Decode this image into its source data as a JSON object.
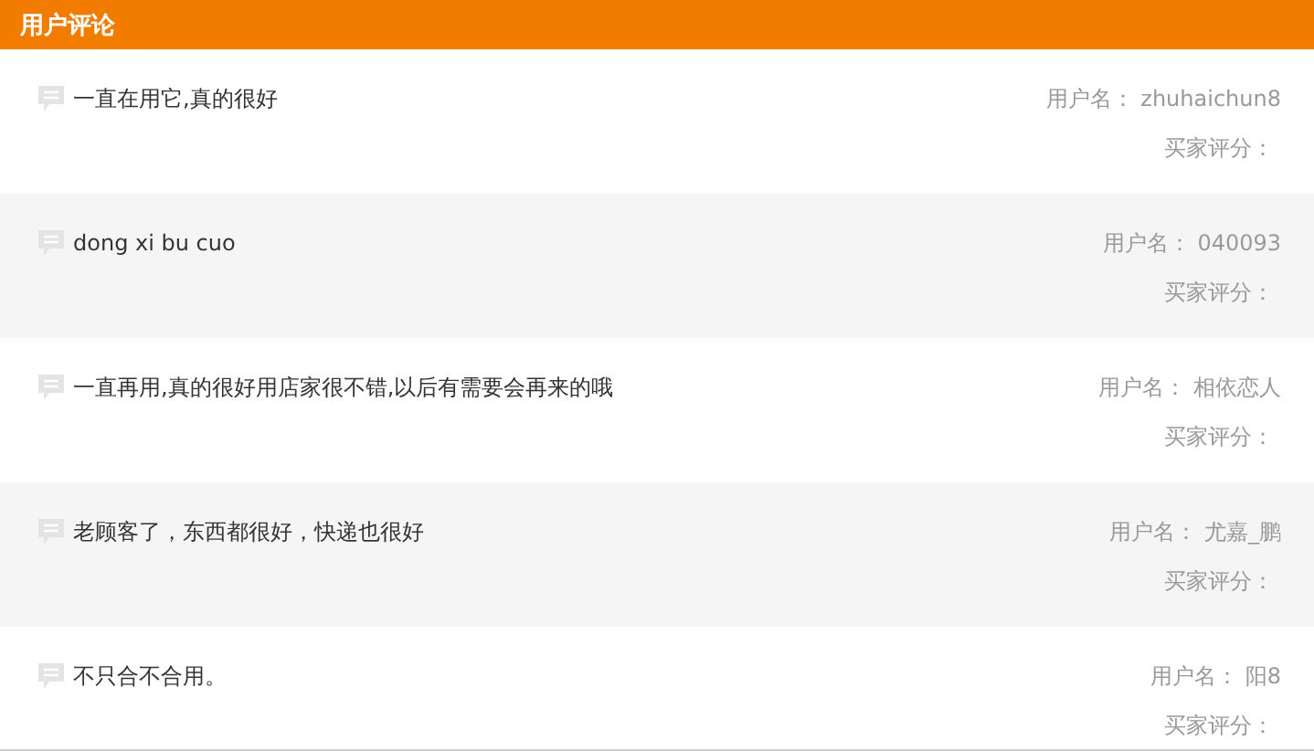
{
  "header": {
    "title": "用户评论"
  },
  "reviews": [
    {
      "comment": "一直在用它,真的很好",
      "username_label": "用户名：",
      "username": "zhuhaichun8",
      "rating_label": "买家评分："
    },
    {
      "comment": "dong xi bu cuo",
      "username_label": "用户名：",
      "username": "040093",
      "rating_label": "买家评分："
    },
    {
      "comment": "一直再用,真的很好用店家很不错,以后有需要会再来的哦",
      "username_label": "用户名：",
      "username": "相依恋人",
      "rating_label": "买家评分："
    },
    {
      "comment": "老顾客了，东西都很好，快递也很好",
      "username_label": "用户名：",
      "username": "尤嘉_鹏",
      "rating_label": "买家评分："
    },
    {
      "comment": "不只合不合用。",
      "username_label": "用户名：",
      "username": "阳8",
      "rating_label": "买家评分："
    }
  ]
}
